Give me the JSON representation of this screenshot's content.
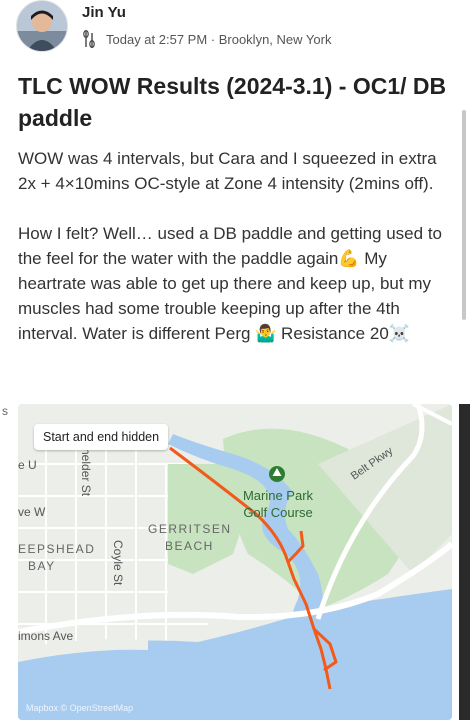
{
  "post": {
    "author": "Jin Yu",
    "timestamp": "Today at 2:57 PM",
    "location": "Brooklyn, New York",
    "meta_line": "Today at 2:57 PM · Brooklyn, New York",
    "title": "TLC WOW Results (2024-3.1) - OC1/ DB paddle",
    "paragraphs": [
      "WOW was 4 intervals, but Cara and I squeezed in extra 2x + 4×10mins OC-style at Zone 4 intensity (2mins off).",
      "How I felt? Well… used a DB paddle and getting used to the feel for the water with the paddle again💪 My heartrate was able to get up there and keep up, but my muscles had some trouble keeping up after the 4th interval. Water is different Perg 🤷‍♂️ Resistance 20☠️"
    ]
  },
  "map": {
    "badge": "Start and end hidden",
    "labels": {
      "marine_park": "Marine Park",
      "golf_course": "Golf Course",
      "gerritsen": "GERRITSEN",
      "beach": "BEACH",
      "sheepshead": "EEPSHEAD",
      "bay": "BAY",
      "belt_pkwy": "Belt Pkwy",
      "schenkolder_st": "helder St",
      "coyle_st": "Coyle St",
      "simmons_ave": "imons Ave",
      "ave_u": "e U",
      "ave_w": "ve W"
    },
    "attribution": "Mapbox © OpenStreetMap",
    "colors": {
      "route": "#f25a1c",
      "water": "#a8ccf0",
      "park": "#c8e3bf",
      "land": "#eceee9",
      "roads": "#ffffff"
    }
  },
  "edge": {
    "left_mark": "s"
  },
  "icons": {
    "paddle": "paddle-icon",
    "map_pin": "park-pin-icon"
  }
}
